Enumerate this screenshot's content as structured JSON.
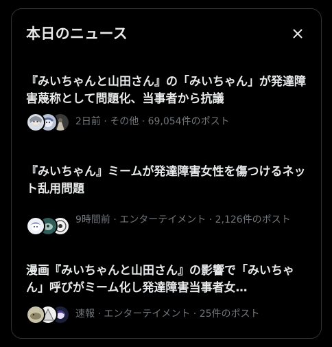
{
  "header": {
    "title": "本日のニュース",
    "close_icon": "close-icon"
  },
  "colors": {
    "background": "#000000",
    "border": "#2f3336",
    "primary_text": "#e7e9ea",
    "secondary_text": "#71767b"
  },
  "news": [
    {
      "title": "『みいちゃんと山田さん』の「みいちゃん」が発達障害蔑称として問題化、当事者から抗議",
      "meta": "2日前 · その他 · 69,054件のポスト",
      "avatar_icons": [
        "anime-avatar-icon",
        "anime-avatar-icon",
        "anime-avatar-icon"
      ]
    },
    {
      "title": "『みいちゃん』ミームが発達障害女性を傷つけるネット乱用問題",
      "meta": "9時間前 · エンターテイメント · 2,126件のポスト",
      "avatar_icons": [
        "anime-avatar-icon",
        "anime-avatar-icon",
        "anime-avatar-icon"
      ]
    },
    {
      "title": "漫画『みいちゃんと山田さん』の影響で「みいちゃん」呼びがミーム化し発達障害当事者女…",
      "meta": "速報 · エンターテイメント · 25件のポスト",
      "avatar_icons": [
        "anime-avatar-icon",
        "anime-avatar-icon",
        "anime-avatar-icon"
      ]
    }
  ]
}
